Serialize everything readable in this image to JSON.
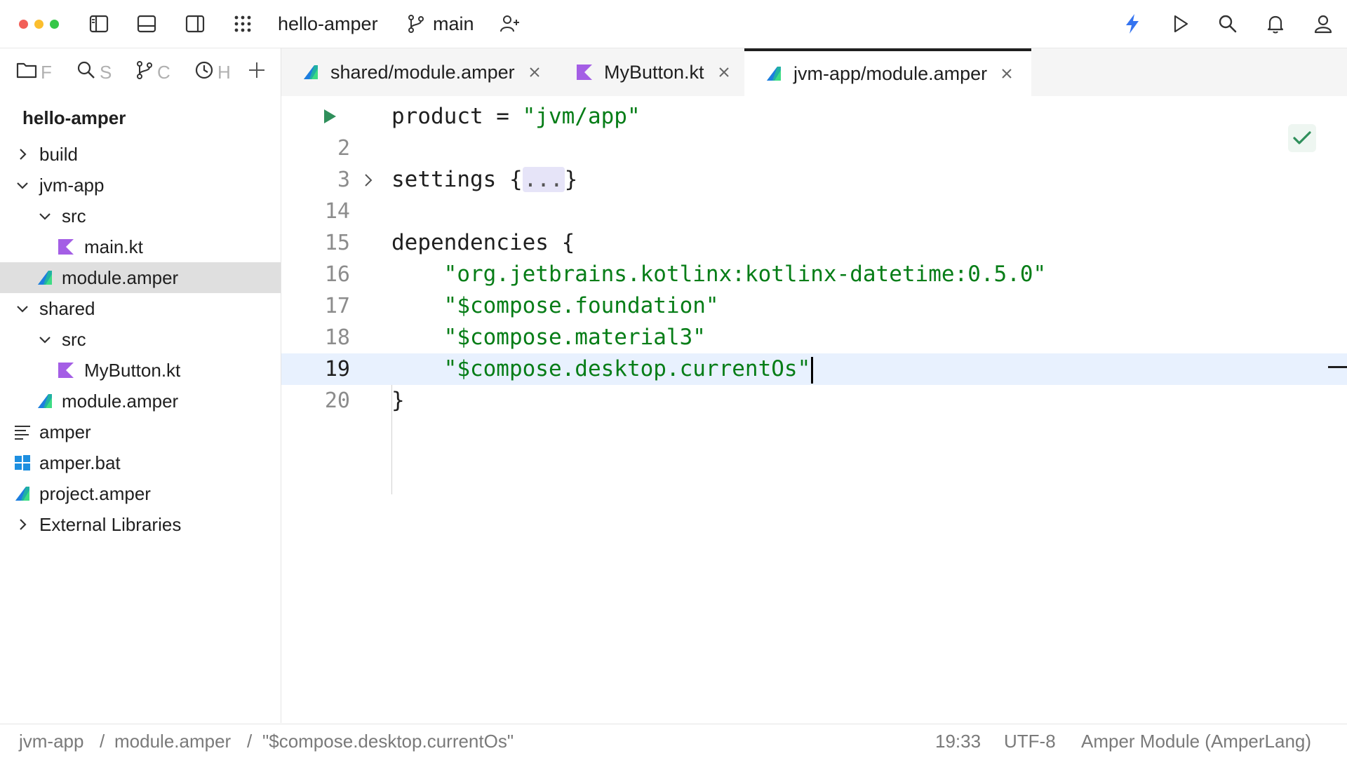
{
  "window": {
    "traffic_lights": [
      "#f25f58",
      "#fbbe2e",
      "#35c748"
    ],
    "project_name": "hello-amper",
    "branch": "main"
  },
  "sidebar": {
    "tabs": [
      {
        "icon": "folder-icon",
        "label": "F"
      },
      {
        "icon": "search-icon",
        "label": "S"
      },
      {
        "icon": "git-branch-icon",
        "label": "C"
      },
      {
        "icon": "clock-icon",
        "label": "H"
      }
    ],
    "root": "hello-amper",
    "tree": [
      {
        "label": "build",
        "icon": "none"
      },
      {
        "label": "jvm-app",
        "icon": "none"
      },
      {
        "label": "src",
        "icon": "none"
      },
      {
        "label": "main.kt",
        "icon": "kotlin-file-icon"
      },
      {
        "label": "module.amper",
        "icon": "amper-file-icon"
      },
      {
        "label": "shared",
        "icon": "none"
      },
      {
        "label": "src",
        "icon": "none"
      },
      {
        "label": "MyButton.kt",
        "icon": "kotlin-file-icon"
      },
      {
        "label": "module.amper",
        "icon": "amper-file-icon"
      },
      {
        "label": "amper",
        "icon": "text-file-icon"
      },
      {
        "label": "amper.bat",
        "icon": "windows-file-icon"
      },
      {
        "label": "project.amper",
        "icon": "amper-file-icon"
      },
      {
        "label": "External Libraries",
        "icon": "none"
      }
    ]
  },
  "tabs": [
    {
      "label": "shared/module.amper",
      "icon": "amper-file-icon",
      "active": false
    },
    {
      "label": "MyButton.kt",
      "icon": "kotlin-file-icon",
      "active": false
    },
    {
      "label": "jvm-app/module.amper",
      "icon": "amper-file-icon",
      "active": true
    }
  ],
  "editor": {
    "lines": [
      {
        "num": "",
        "segments": [
          [
            "product = ",
            ""
          ],
          [
            "\"jvm/app\"",
            "str"
          ]
        ]
      },
      {
        "num": "2",
        "segments": []
      },
      {
        "num": "3",
        "segments": [
          [
            "settings {",
            ""
          ],
          [
            "...",
            "fold"
          ],
          [
            "}",
            ""
          ]
        ]
      },
      {
        "num": "14",
        "segments": []
      },
      {
        "num": "15",
        "segments": [
          [
            "dependencies {",
            ""
          ]
        ]
      },
      {
        "num": "16",
        "segments": [
          [
            "    ",
            ""
          ],
          [
            "\"org.jetbrains.kotlinx:kotlinx-datetime:0.5.0\"",
            "str"
          ]
        ]
      },
      {
        "num": "17",
        "segments": [
          [
            "    ",
            ""
          ],
          [
            "\"$compose.foundation\"",
            "str"
          ]
        ]
      },
      {
        "num": "18",
        "segments": [
          [
            "    ",
            ""
          ],
          [
            "\"$compose.material3\"",
            "str"
          ]
        ]
      },
      {
        "num": "19",
        "segments": [
          [
            "    ",
            ""
          ],
          [
            "\"$compose.desktop.currentOs\"",
            "str"
          ]
        ],
        "current": true
      },
      {
        "num": "20",
        "segments": [
          [
            "}",
            ""
          ]
        ]
      }
    ]
  },
  "statusbar": {
    "breadcrumb": [
      "jvm-app",
      "module.amper",
      "\"$compose.desktop.currentOs\""
    ],
    "separator": "/",
    "position": "19:33",
    "encoding": "UTF-8",
    "language": "Amper Module (AmperLang)"
  },
  "colors": {
    "string": "#067d17",
    "accent": "#3574f0",
    "run_green": "#2f8f5b",
    "kotlin": "#a45ee5",
    "amper_teal": "#20b1a3"
  }
}
